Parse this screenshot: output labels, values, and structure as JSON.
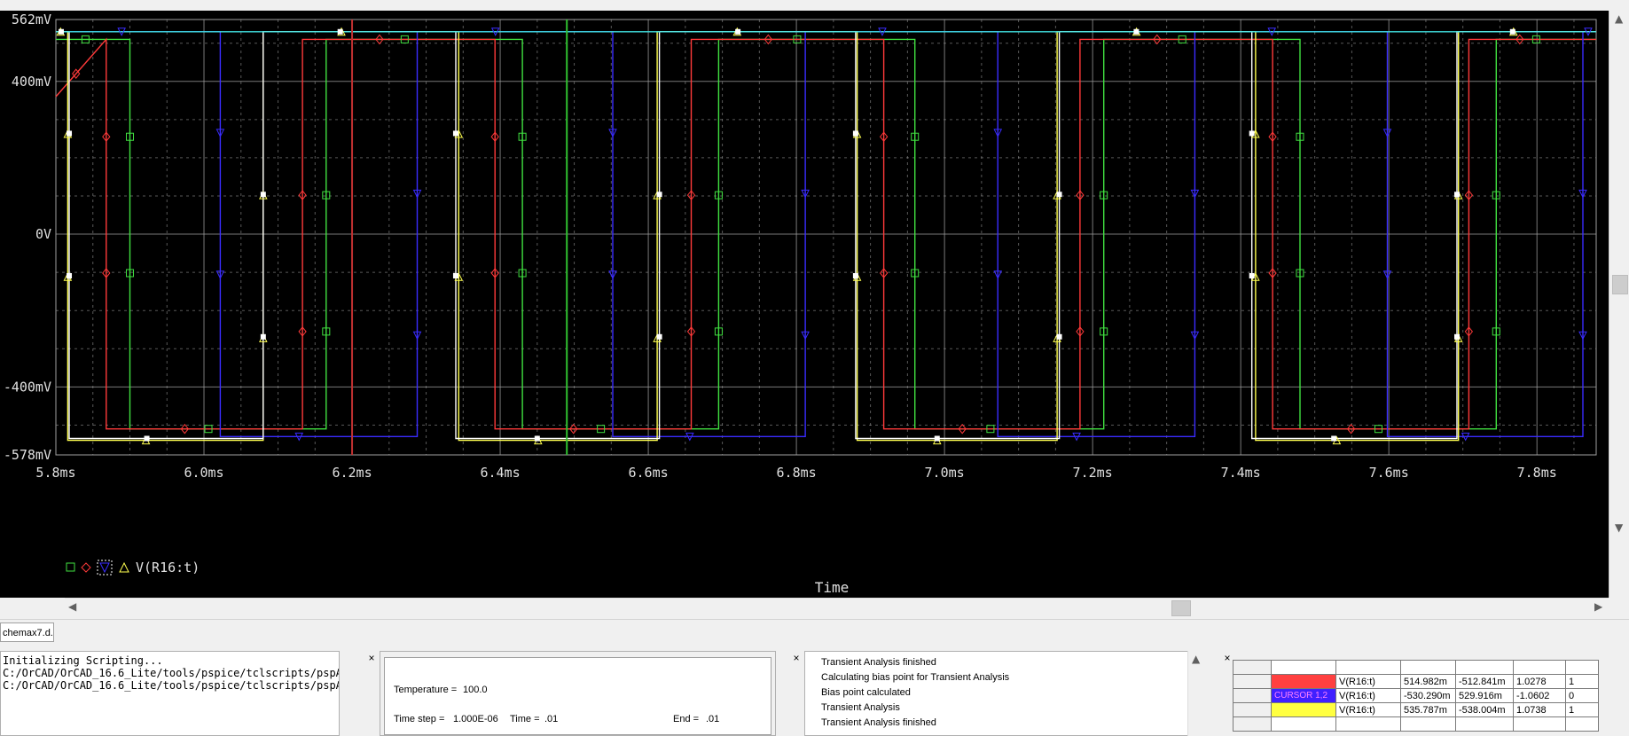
{
  "plot": {
    "y_axis_labels": [
      "562mV",
      "400mV",
      "0V",
      "-400mV",
      "-578mV"
    ],
    "x_axis_labels": [
      "5.8ms",
      "6.0ms",
      "6.2ms",
      "6.4ms",
      "6.6ms",
      "6.8ms",
      "7.0ms",
      "7.2ms",
      "7.4ms",
      "7.6ms",
      "7.8ms"
    ],
    "x_title": "Time",
    "legend_trace": "V(R16:t)",
    "colors": {
      "red": "#ff3a3a",
      "green": "#40e040",
      "blue": "#3a2cff",
      "yellow": "#ffff50",
      "white": "#ffffff",
      "cyan": "#40e0e0",
      "grid": "#a0a0a0"
    }
  },
  "chart_data": {
    "type": "line",
    "xlabel": "Time",
    "ylabel": "",
    "xlim": [
      5.8,
      7.88
    ],
    "ylim": [
      -0.578,
      0.562
    ],
    "x_units": "ms",
    "y_units": "V",
    "series": [
      {
        "name": "V(R16:t)",
        "color": "#40e040",
        "marker": "square",
        "x": [
          5.8,
          5.9,
          5.9,
          6.165,
          6.165,
          6.43,
          6.43,
          6.695,
          6.695,
          6.96,
          6.96,
          7.215,
          7.215,
          7.48,
          7.48,
          7.745,
          7.745,
          7.88
        ],
        "y": [
          0.51,
          0.51,
          -0.51,
          -0.51,
          0.51,
          0.51,
          -0.51,
          -0.51,
          0.51,
          0.51,
          -0.51,
          -0.51,
          0.51,
          0.51,
          -0.51,
          -0.51,
          0.51,
          0.51
        ]
      },
      {
        "name": "V(R16:t)",
        "color": "#ff3a3a",
        "marker": "diamond",
        "x": [
          5.8,
          5.868,
          5.868,
          6.133,
          6.133,
          6.393,
          6.393,
          6.658,
          6.658,
          6.918,
          6.918,
          7.183,
          7.183,
          7.443,
          7.443,
          7.708,
          7.708,
          7.88
        ],
        "y": [
          0.36,
          0.51,
          -0.51,
          -0.51,
          0.51,
          0.51,
          -0.51,
          -0.51,
          0.51,
          0.51,
          -0.51,
          -0.51,
          0.51,
          0.51,
          -0.51,
          -0.51,
          0.51,
          0.51
        ]
      },
      {
        "name": "V(R16:t)",
        "color": "#3a2cff",
        "marker": "triangle-down",
        "x": [
          5.8,
          6.022,
          6.022,
          6.288,
          6.288,
          6.552,
          6.552,
          6.812,
          6.812,
          7.072,
          7.072,
          7.338,
          7.338,
          7.598,
          7.598,
          7.862,
          7.862,
          7.88
        ],
        "y": [
          0.53,
          0.53,
          -0.53,
          -0.53,
          0.53,
          0.53,
          -0.53,
          -0.53,
          0.53,
          0.53,
          -0.53,
          -0.53,
          0.53,
          0.53,
          -0.53,
          -0.53,
          0.53,
          0.53
        ]
      },
      {
        "name": "V(R16:t)",
        "color": "#ffff50",
        "marker": "triangle-up",
        "x": [
          5.8,
          5.816,
          5.816,
          6.08,
          6.08,
          6.344,
          6.344,
          6.612,
          6.612,
          6.882,
          6.882,
          7.152,
          7.152,
          7.42,
          7.42,
          7.694,
          7.694,
          7.88
        ],
        "y": [
          0.53,
          0.53,
          -0.54,
          -0.54,
          0.53,
          0.53,
          -0.54,
          -0.54,
          0.53,
          0.53,
          -0.54,
          -0.54,
          0.53,
          0.53,
          -0.54,
          -0.54,
          0.53,
          0.53
        ]
      },
      {
        "name": "V(R16:t)",
        "color": "#ffffff",
        "marker": "square-filled",
        "x": [
          5.8,
          5.818,
          5.818,
          6.08,
          6.08,
          6.34,
          6.34,
          6.615,
          6.615,
          6.88,
          6.88,
          7.155,
          7.155,
          7.415,
          7.415,
          7.692,
          7.692,
          7.88
        ],
        "y": [
          0.53,
          0.53,
          -0.535,
          -0.535,
          0.53,
          0.53,
          -0.535,
          -0.535,
          0.53,
          0.53,
          -0.535,
          -0.535,
          0.53,
          0.53,
          -0.535,
          -0.535,
          0.53,
          0.53
        ]
      },
      {
        "name": "",
        "color": "#40e0e0",
        "marker": "none",
        "x": [
          5.8,
          7.88
        ],
        "y": [
          0.53,
          0.53
        ]
      }
    ]
  },
  "doc_tab": "chemax7.d...",
  "console": {
    "lines": [
      "Initializing Scripting...",
      "C:/OrCAD/OrCAD_16.6_Lite/tools/pspice/tclscripts/pspA",
      "C:/OrCAD/OrCAD_16.6_Lite/tools/pspice/tclscripts/pspA"
    ]
  },
  "sim_status": {
    "temperature_label": "Temperature =",
    "temperature_value": "100.0",
    "timestep_label": "Time step =",
    "timestep_value": "1.000E-06",
    "time_label": "Time =",
    "time_value": ".01",
    "end_label": "End =",
    "end_value": ".01"
  },
  "sim_output": {
    "lines": [
      "Transient Analysis finished",
      "Calculating bias point for Transient Analysis",
      "Bias point calculated",
      "Transient Analysis",
      "Transient Analysis finished"
    ]
  },
  "cursor_table": {
    "rows": [
      {
        "color": "#ff4040",
        "label": "",
        "trace": "V(R16:t)",
        "v1": "514.982m",
        "v2": "-512.841m",
        "diff": "1.0278",
        "extra": "1"
      },
      {
        "color": "#4020ff",
        "label": "CURSOR 1,2",
        "trace": "V(R16:t)",
        "v1": "-530.290m",
        "v2": "529.916m",
        "diff": "-1.0602",
        "extra": "0"
      },
      {
        "color": "#ffff40",
        "label": "",
        "trace": "V(R16:t)",
        "v1": "535.787m",
        "v2": "-538.004m",
        "diff": "1.0738",
        "extra": "1"
      }
    ]
  }
}
